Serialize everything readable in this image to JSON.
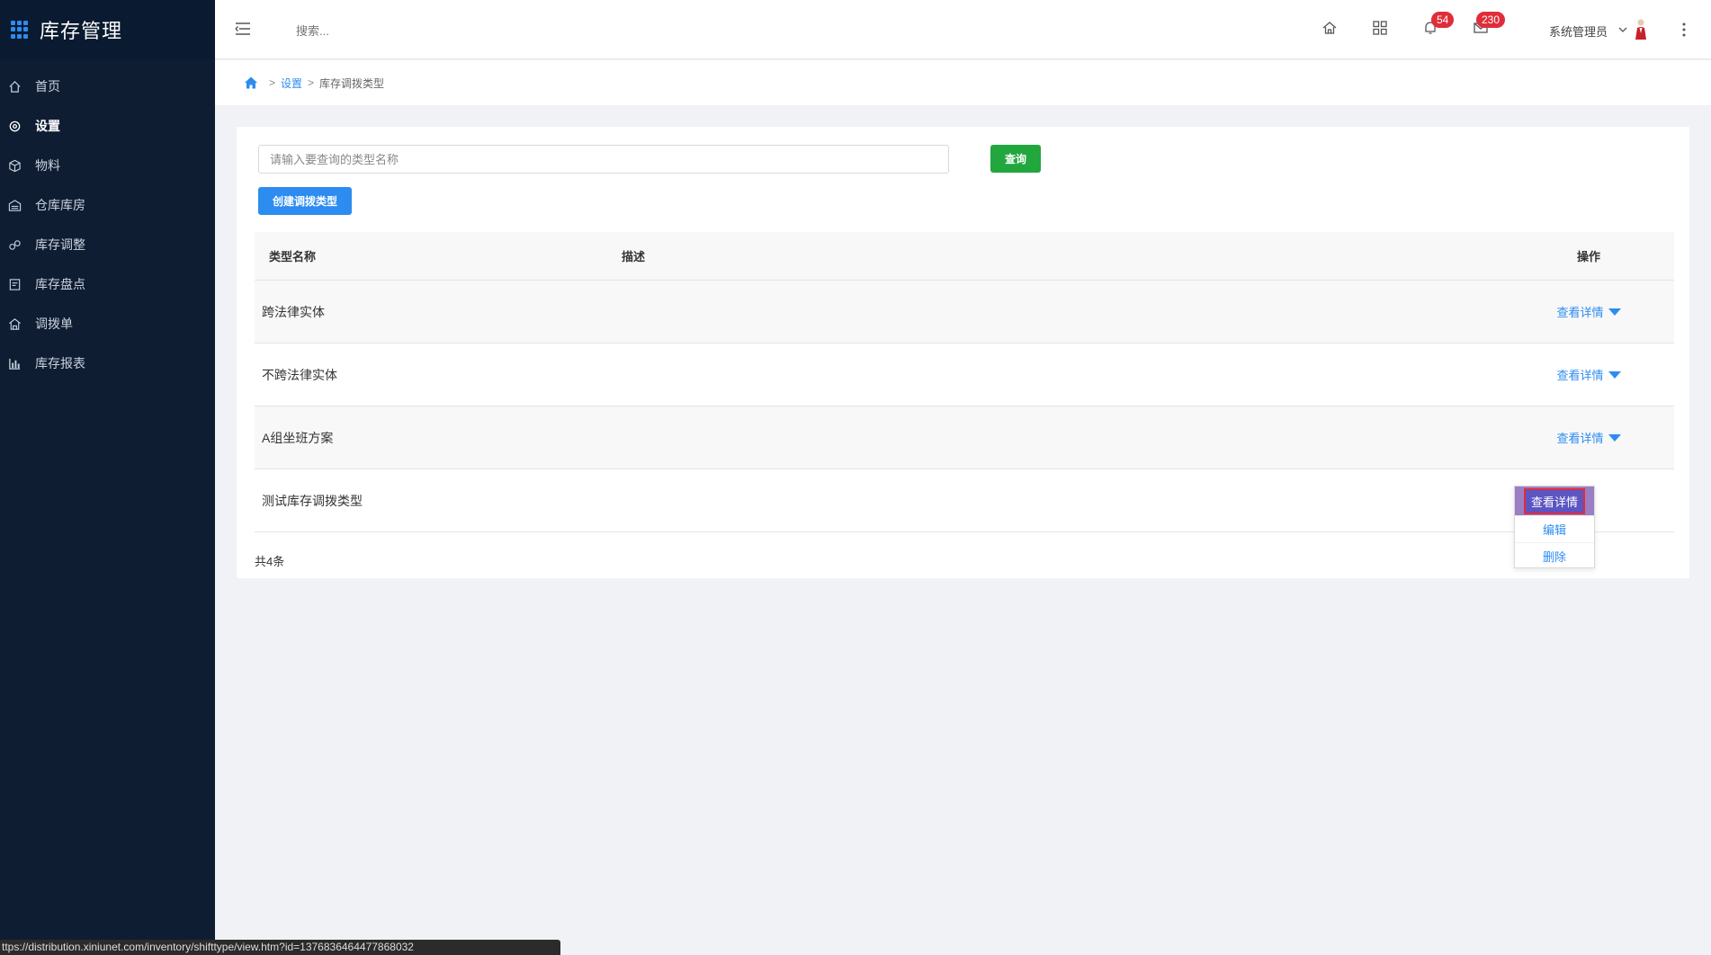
{
  "app": {
    "title": "库存管理",
    "brand_color": "#2d8cf0"
  },
  "sidebar": {
    "items": [
      {
        "label": "首页",
        "icon": "home-icon"
      },
      {
        "label": "设置",
        "icon": "gear-icon",
        "active": true
      },
      {
        "label": "物料",
        "icon": "box-icon"
      },
      {
        "label": "仓库库房",
        "icon": "warehouse-icon"
      },
      {
        "label": "库存调整",
        "icon": "adjust-icon"
      },
      {
        "label": "库存盘点",
        "icon": "inventory-check-icon"
      },
      {
        "label": "调拨单",
        "icon": "transfer-icon"
      },
      {
        "label": "库存报表",
        "icon": "chart-icon"
      }
    ]
  },
  "header": {
    "search_placeholder": "搜索...",
    "notifications_count": "54",
    "messages_count": "230",
    "user_name": "系统管理员"
  },
  "breadcrumb": {
    "items": [
      "设置",
      "库存调拨类型"
    ]
  },
  "query": {
    "placeholder": "请输入要查询的类型名称",
    "query_button": "查询",
    "create_button": "创建调拨类型"
  },
  "table": {
    "headers": {
      "name": "类型名称",
      "desc": "描述",
      "op": "操作"
    },
    "rows": [
      {
        "name": "跨法律实体",
        "desc": "",
        "action": "查看详情"
      },
      {
        "name": "不跨法律实体",
        "desc": "",
        "action": "查看详情"
      },
      {
        "name": "A组坐班方案",
        "desc": "",
        "action": "查看详情"
      },
      {
        "name": "测试库存调拨类型",
        "desc": "",
        "action": "查看详情"
      }
    ],
    "total": "共4条"
  },
  "dropdown": {
    "active_label": "查看详情",
    "items": [
      "编辑",
      "删除"
    ]
  },
  "statusbar": {
    "url": "ttps://distribution.xiniunet.com/inventory/shifttype/view.htm?id=1376836464477868032"
  }
}
